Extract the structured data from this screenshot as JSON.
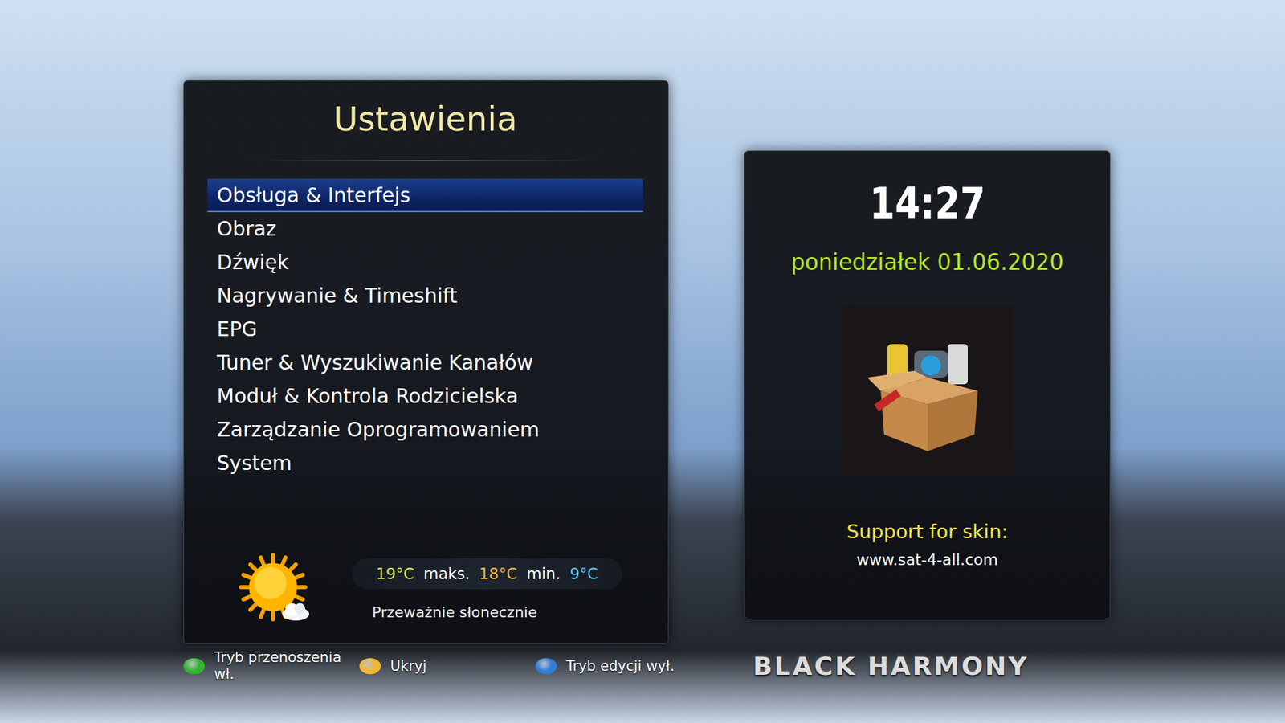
{
  "settings": {
    "title": "Ustawienia",
    "items": [
      {
        "label": "Obsługa & Interfejs",
        "selected": true
      },
      {
        "label": "Obraz",
        "selected": false
      },
      {
        "label": "Dźwięk",
        "selected": false
      },
      {
        "label": "Nagrywanie & Timeshift",
        "selected": false
      },
      {
        "label": "EPG",
        "selected": false
      },
      {
        "label": "Tuner & Wyszukiwanie Kanałów",
        "selected": false
      },
      {
        "label": "Moduł & Kontrola Rodzicielska",
        "selected": false
      },
      {
        "label": "Zarządzanie Oprogramowaniem",
        "selected": false
      },
      {
        "label": "System",
        "selected": false
      }
    ]
  },
  "weather": {
    "current": "19°C",
    "max_label": "maks.",
    "max": "18°C",
    "min_label": "min.",
    "min": "9°C",
    "description": "Przeważnie słonecznie"
  },
  "clock": {
    "time": "14:27",
    "date": "poniedziałek 01.06.2020"
  },
  "support": {
    "label": "Support for skin:",
    "url": "www.sat-4-all.com"
  },
  "buttons": [
    {
      "label": "Tryb przenoszenia wł.",
      "color": "#2fb52f"
    },
    {
      "label": "Ukryj",
      "color": "#f2b632"
    },
    {
      "label": "Tryb edycji wył.",
      "color": "#2f7fd8"
    }
  ],
  "logo": "BLACK HARMONY"
}
